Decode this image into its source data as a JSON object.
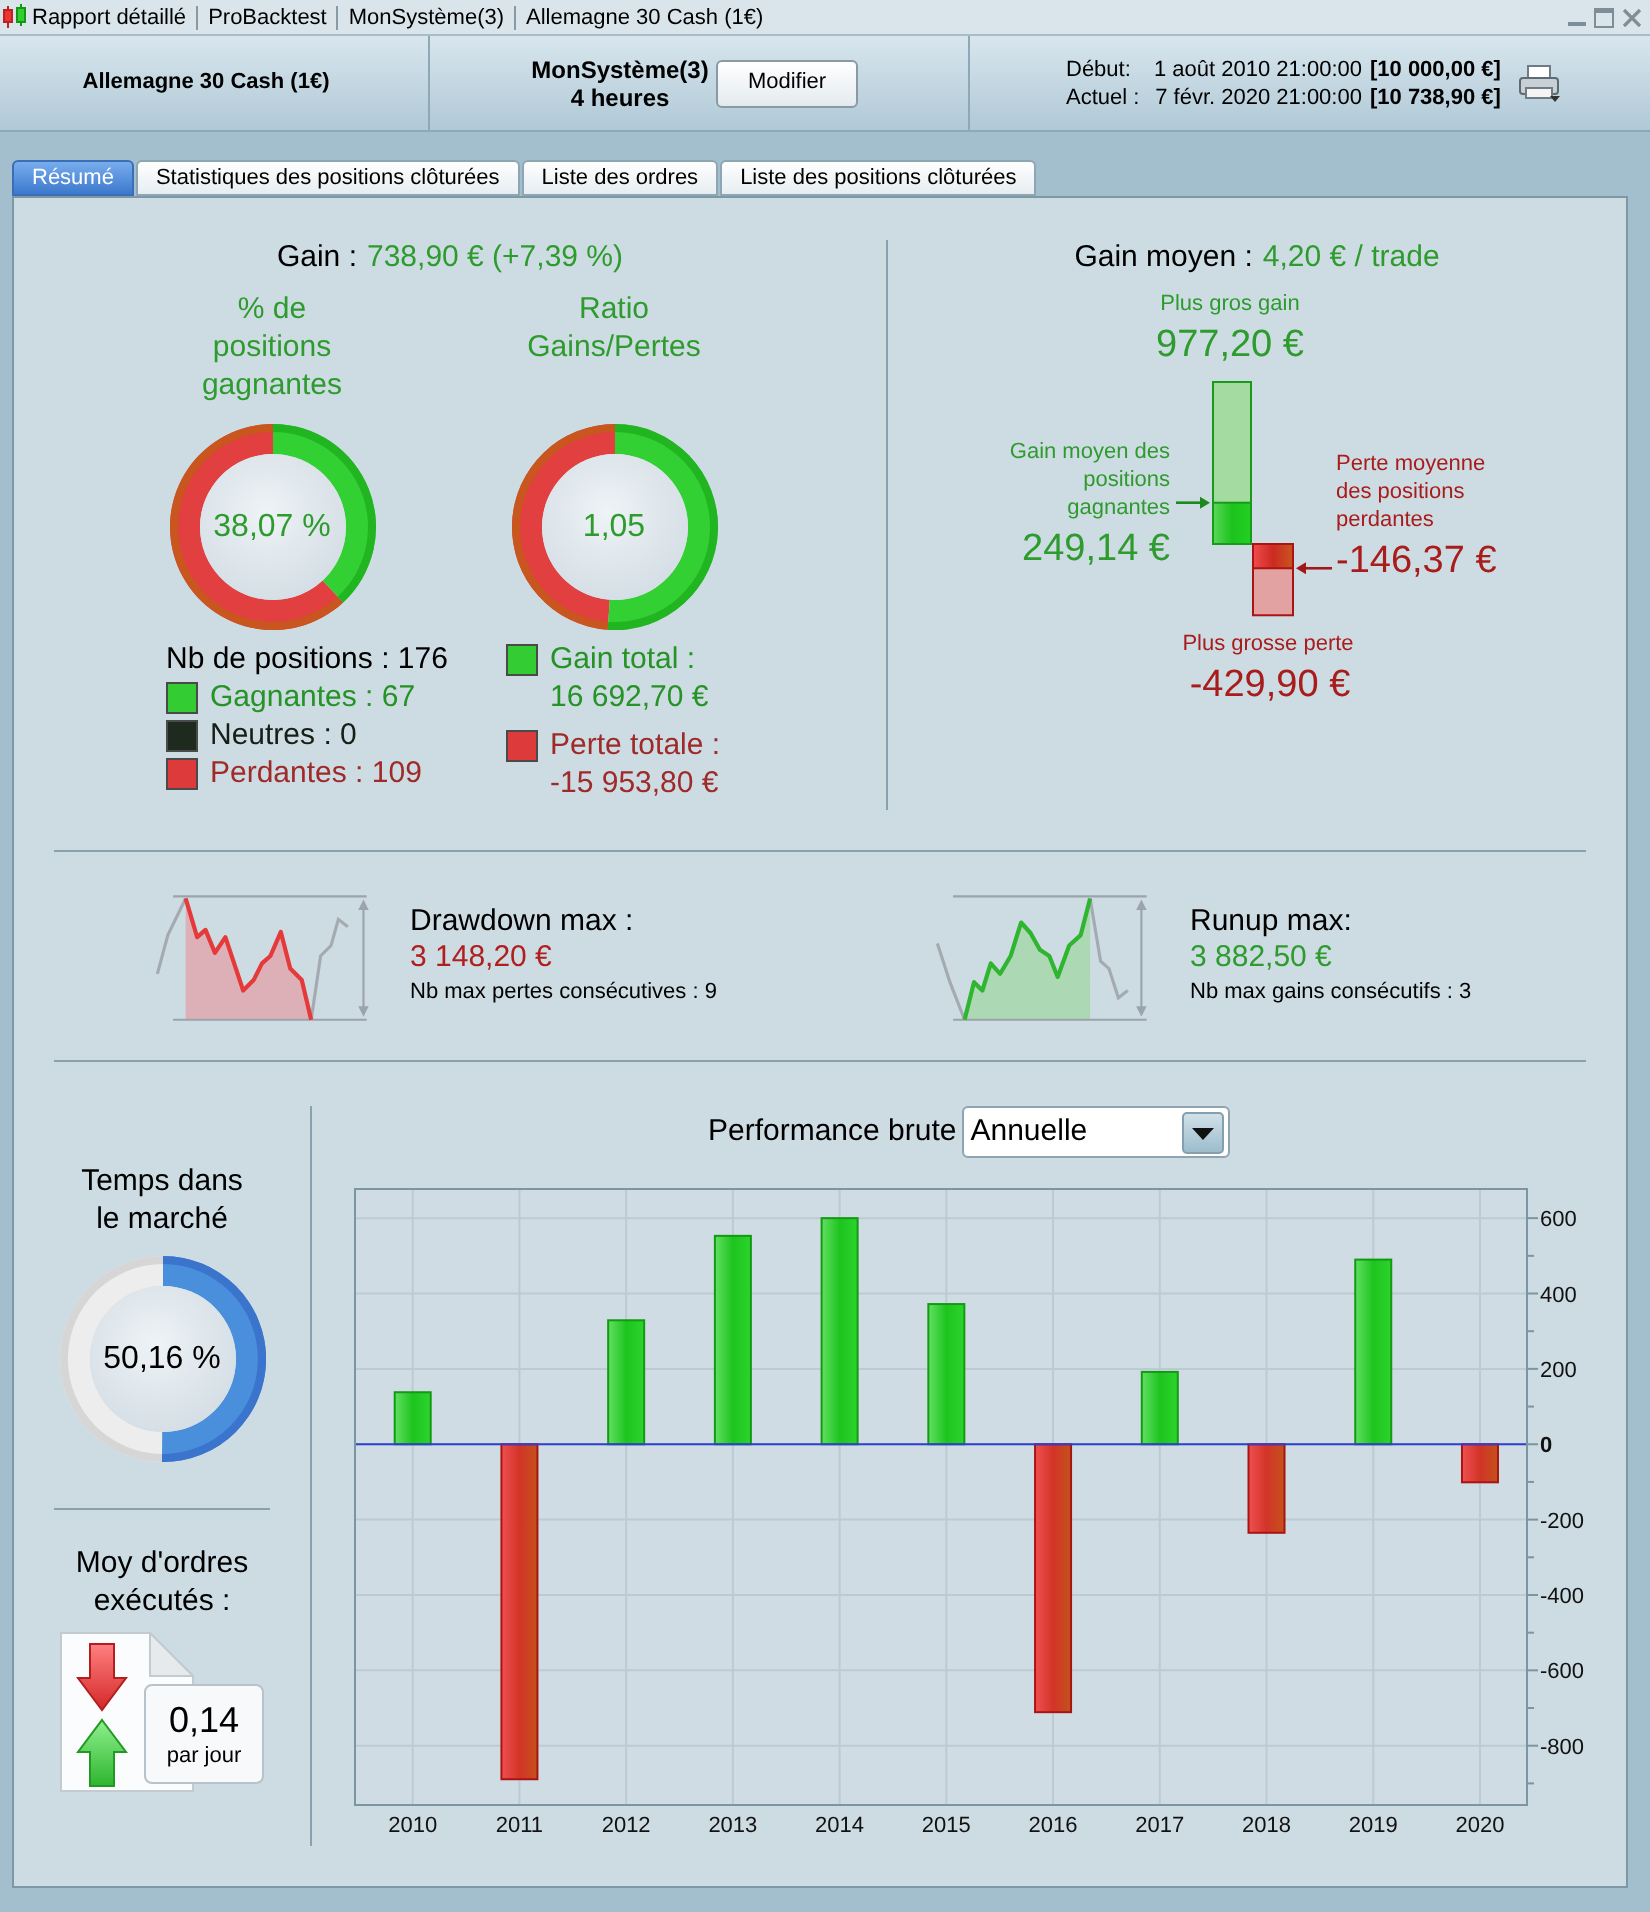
{
  "title_bar": {
    "segments": [
      "Rapport détaillé",
      "ProBacktest",
      "MonSystème(3)",
      "Allemagne 30 Cash (1€)"
    ]
  },
  "header": {
    "instrument": "Allemagne 30 Cash (1€)",
    "system": "MonSystème(3)",
    "timeframe": "4 heures",
    "modify_button": "Modifier",
    "periods": [
      {
        "label": "Début:",
        "date": "1 août 2010 21:00:00",
        "capital": "[10 000,00 €]"
      },
      {
        "label": "Actuel :",
        "date": "7 févr. 2020 21:00:00",
        "capital": "[10 738,90 €]"
      }
    ]
  },
  "tabs": [
    {
      "label": "Résumé",
      "selected": true
    },
    {
      "label": "Statistiques des positions clôturées",
      "selected": false
    },
    {
      "label": "Liste des ordres",
      "selected": false
    },
    {
      "label": "Liste des positions clôturées",
      "selected": false
    }
  ],
  "gain": {
    "label": "Gain :",
    "value": "738,90 € (+7,39 %)"
  },
  "win_rate": {
    "title": "% de positions gagnantes",
    "reading": "38,07 %",
    "total": "Nb de positions : 176",
    "breakdown": [
      {
        "label": "Gagnantes : 67",
        "color": "#33cc33"
      },
      {
        "label": "Neutres : 0",
        "color": "#1f2a1f"
      },
      {
        "label": "Perdantes : 109",
        "color": "#dd3b3b"
      }
    ]
  },
  "ratio": {
    "title": "Ratio Gains/Pertes",
    "level": 0.5113,
    "reading": "1,05",
    "totals": [
      {
        "label": "Gain total :",
        "value": "16 692,70 €",
        "color": "#33cc33"
      },
      {
        "label": "Perte totale :",
        "value": "-15 953,80 €",
        "color": "#dd3b3b"
      }
    ]
  },
  "average_gain": {
    "label": "Gain moyen :",
    "value": "4,20 € / trade",
    "largest_gain": {
      "label": "Plus gros gain",
      "value": "977,20 €"
    },
    "average_winner": {
      "label": "Gain moyen des positions gagnantes",
      "value": "249,14 €"
    },
    "average_loser": {
      "label": "Perte moyenne des positions perdantes",
      "value": "-146,37 €"
    },
    "largest_loss": {
      "label": "Plus grosse perte",
      "value": "-429,90 €"
    }
  },
  "extremes": [
    {
      "kind": "drawdown",
      "label": "Drawdown max :",
      "value": "3 148,20 €",
      "streak": "Nb max pertes consécutives : 9"
    },
    {
      "kind": "runup",
      "label": "Runup max:",
      "value": "3 882,50 €",
      "streak": "Nb max gains consécutifs : 3"
    }
  ],
  "market_time": {
    "title": "Temps dans le marché",
    "level": 0.5016,
    "reading": "50,16 %"
  },
  "orders": {
    "title": "Moy d'ordres exécutés :",
    "value": "0,14",
    "unit": "par jour"
  },
  "performance": {
    "label": "Performance brute",
    "period": "Annuelle",
    "chart_data": {
      "type": "bar",
      "categories": [
        "2010",
        "2011",
        "2012",
        "2013",
        "2014",
        "2015",
        "2016",
        "2017",
        "2018",
        "2019",
        "2020"
      ],
      "values": [
        138,
        -889,
        329,
        553,
        600,
        372,
        -711,
        192,
        -235,
        490,
        -101
      ],
      "ylim": [
        -960,
        680
      ],
      "yticks": [
        -800,
        -600,
        -400,
        -200,
        0,
        200,
        400,
        600
      ],
      "grid": true,
      "ref_lines": [
        {
          "axis": "y",
          "value": 0,
          "color": "#2f3fd0"
        }
      ]
    }
  }
}
